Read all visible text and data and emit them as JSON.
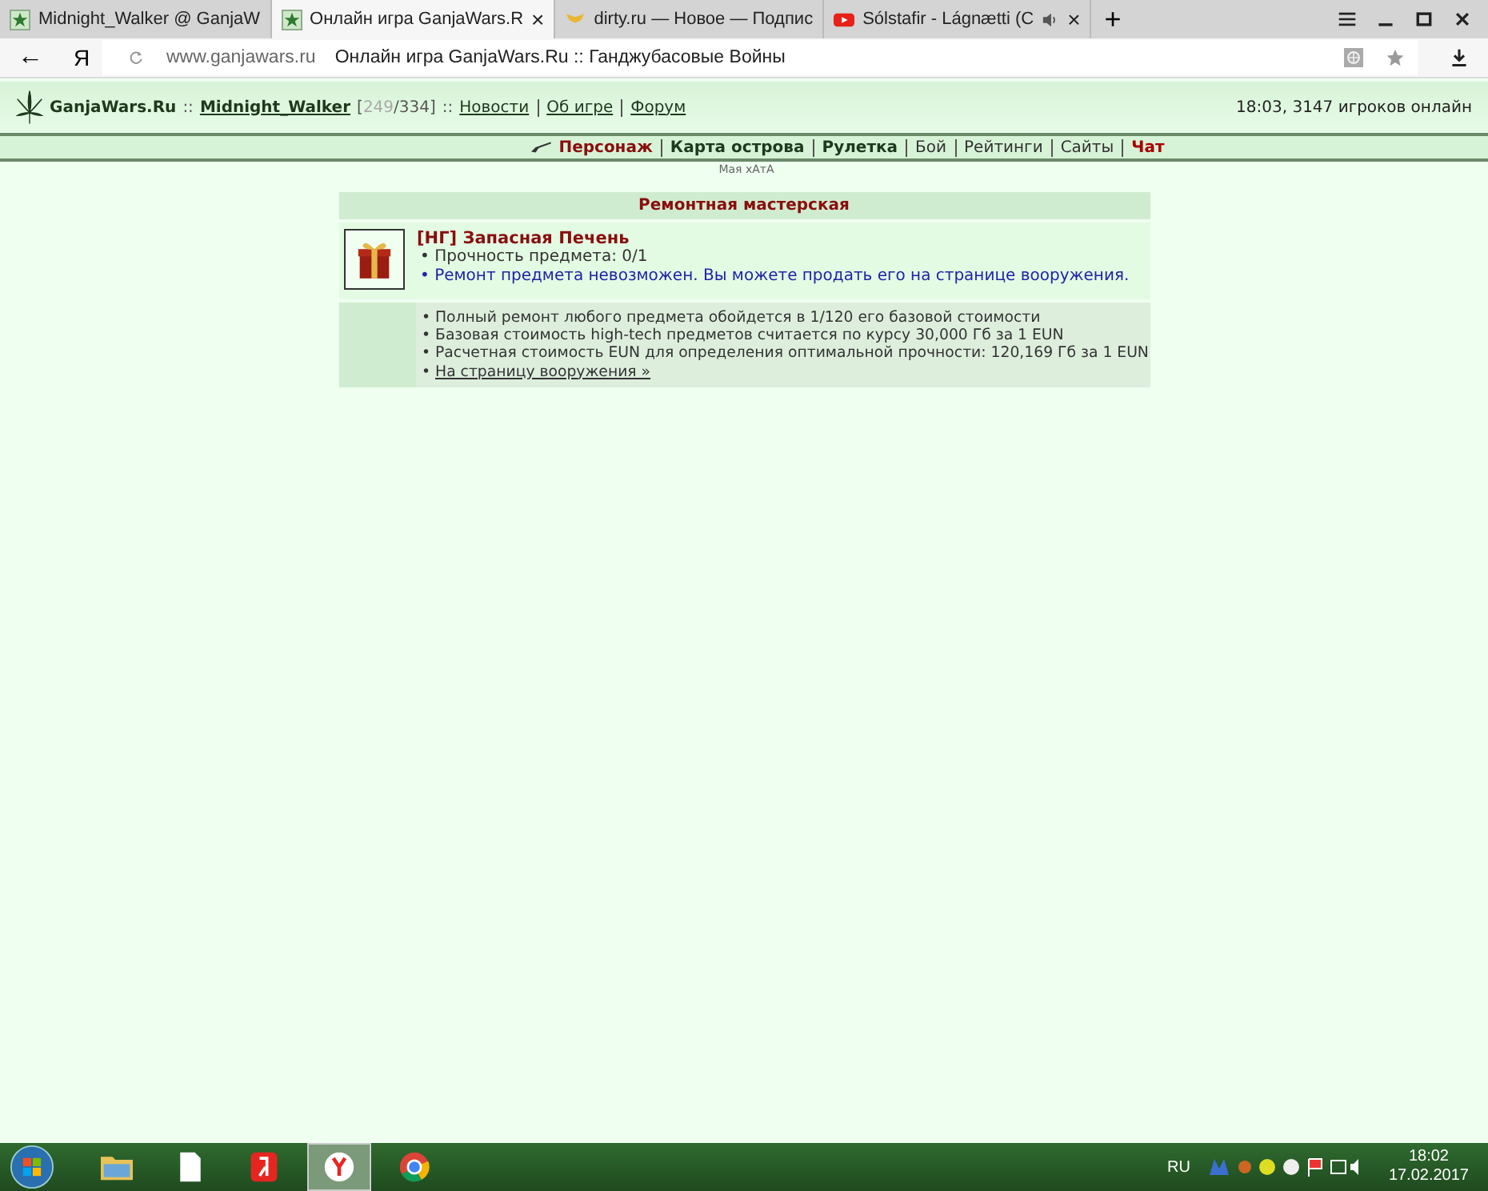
{
  "browser": {
    "tabs": [
      {
        "title": "Midnight_Walker @ GanjaW",
        "kind": "leaf",
        "selected": false,
        "audio": false
      },
      {
        "title": "Онлайн игра GanjaWars.R",
        "kind": "leaf",
        "selected": true,
        "audio": false,
        "close": "×"
      },
      {
        "title": "dirty.ru — Новое — Подпис",
        "kind": "wings",
        "selected": false,
        "audio": false
      },
      {
        "title": "Sólstafir - Lágnætti (С",
        "kind": "video",
        "selected": false,
        "audio": true,
        "close": "×"
      }
    ],
    "new_tab": "+",
    "back": "←",
    "yandex": "Я",
    "url": "www.ganjawars.ru",
    "page_title": "Онлайн игра GanjaWars.Ru :: Ганджубасовые Войны"
  },
  "header": {
    "site": "GanjaWars.Ru",
    "sep_a": "::",
    "user": "Midnight_Walker",
    "stats_open": "[",
    "stats_current": "249",
    "stats_rest": "/334]",
    "sep_b": "::",
    "links": [
      "Новости",
      "Об игре",
      "Форум"
    ],
    "status": "18:03, 3147 игроков онлайн"
  },
  "nav": {
    "items": [
      {
        "label": "Персонаж",
        "kind": "active"
      },
      {
        "label": "Карта острова",
        "kind": "bold"
      },
      {
        "label": "Рулетка",
        "kind": "bold"
      },
      {
        "label": "Бой",
        "kind": "plain"
      },
      {
        "label": "Рейтинги",
        "kind": "plain"
      },
      {
        "label": "Сайты",
        "kind": "plain"
      },
      {
        "label": "Чат",
        "kind": "alert"
      }
    ],
    "subtitle": "Мая хАтА"
  },
  "workshop": {
    "title": "Ремонтная мастерская",
    "item": {
      "name": "[НГ] Запасная Печень",
      "lines": [
        {
          "text": "• Прочность предмета: 0/1",
          "kind": "plain"
        },
        {
          "text": "• Ремонт предмета невозможен. Вы можете продать его на странице вооружения.",
          "kind": "notice"
        }
      ]
    },
    "notes": [
      "• Полный ремонт любого предмета обойдется в 1/120 его базовой стоимости",
      "• Базовая стоимость high-tech предметов считается по курсу 30,000 Гб за 1 EUN",
      "• Расчетная стоимость EUN для определения оптимальной прочности: 120,169 Гб за 1 EUN"
    ],
    "link_bullet": "•",
    "link": "На страницу вооружения »"
  },
  "taskbar": {
    "apps": [
      {
        "kind": "explorer",
        "selected": false
      },
      {
        "kind": "file",
        "selected": false
      },
      {
        "kind": "yandex",
        "selected": false
      },
      {
        "kind": "yandex-browser",
        "selected": true
      },
      {
        "kind": "chrome",
        "selected": false
      }
    ],
    "language": "RU",
    "time": "18:02",
    "date": "17.02.2017"
  }
}
